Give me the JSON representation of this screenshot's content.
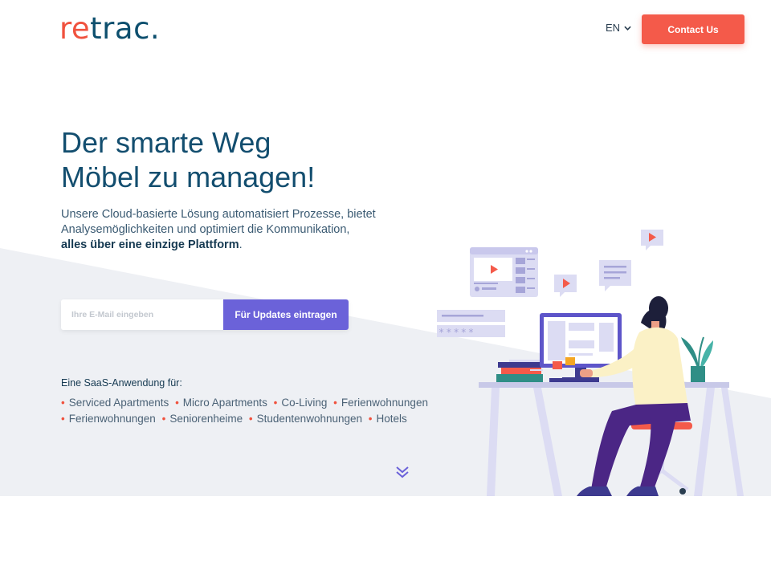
{
  "header": {
    "logo_accent": "re",
    "logo_rest": "trac.",
    "language": "EN",
    "contact_label": "Contact Us"
  },
  "hero": {
    "headline_line1": "Der smarte Weg",
    "headline_line2": "Möbel zu managen!",
    "description": "Unsere Cloud-basierte Lösung automatisiert Prozesse, bietet Analysemöglichkeiten und optimiert die Kommunikation,",
    "description_bold": "alles über eine einzige Plattform",
    "description_end": "."
  },
  "signup": {
    "placeholder": "Ihre E-Mail eingeben",
    "button_label": "Für Updates eintragen"
  },
  "saas": {
    "label": "Eine SaaS-Anwendung für:",
    "items": [
      "Serviced Apartments",
      "Micro Apartments",
      "Co-Living",
      "Ferienwohnungen",
      "Ferienwohnungen",
      "Seniorenheime",
      "Studentenwohnungen",
      "Hotels"
    ]
  },
  "illustration": {
    "password_mask": "*****"
  },
  "colors": {
    "brand_red": "#f45a4a",
    "brand_navy": "#134e6f",
    "accent_purple": "#6b62d9",
    "hero_bg": "#eef0f4"
  },
  "icons": {
    "language_chevron": "chevron-down-icon",
    "scroll": "double-chevron-down-icon"
  }
}
